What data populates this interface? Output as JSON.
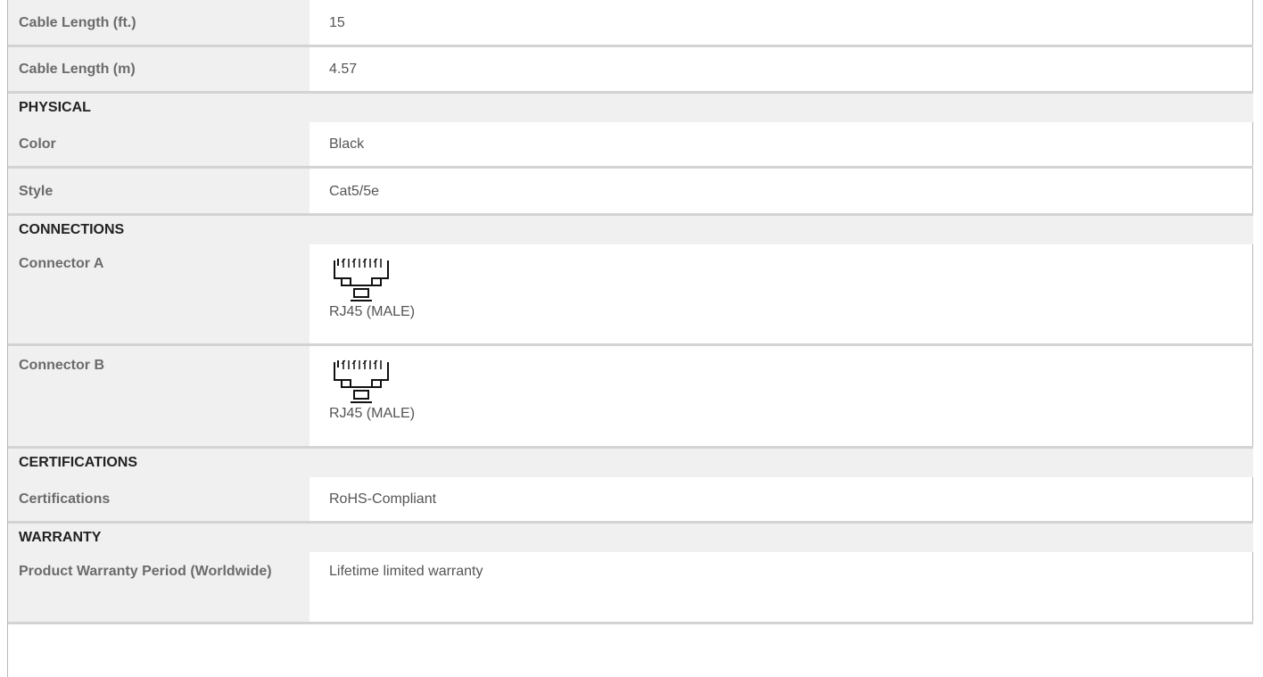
{
  "rows_top": [
    {
      "label": "Cable Length (ft.)",
      "value": "15"
    },
    {
      "label": "Cable Length (m)",
      "value": "4.57"
    }
  ],
  "physical": {
    "heading": "PHYSICAL",
    "rows": [
      {
        "label": "Color",
        "value": "Black"
      },
      {
        "label": "Style",
        "value": "Cat5/5e"
      }
    ]
  },
  "connections": {
    "heading": "CONNECTIONS",
    "rows": [
      {
        "label": "Connector A",
        "value": "RJ45 (MALE)",
        "icon": "rj45-connector-icon"
      },
      {
        "label": "Connector B",
        "value": "RJ45 (MALE)",
        "icon": "rj45-connector-icon"
      }
    ]
  },
  "certifications": {
    "heading": "CERTIFICATIONS",
    "rows": [
      {
        "label": "Certifications",
        "value": "RoHS-Compliant"
      }
    ]
  },
  "warranty": {
    "heading": "WARRANTY",
    "rows": [
      {
        "label": "Product Warranty Period (Worldwide)",
        "value": "Lifetime limited warranty"
      }
    ]
  }
}
